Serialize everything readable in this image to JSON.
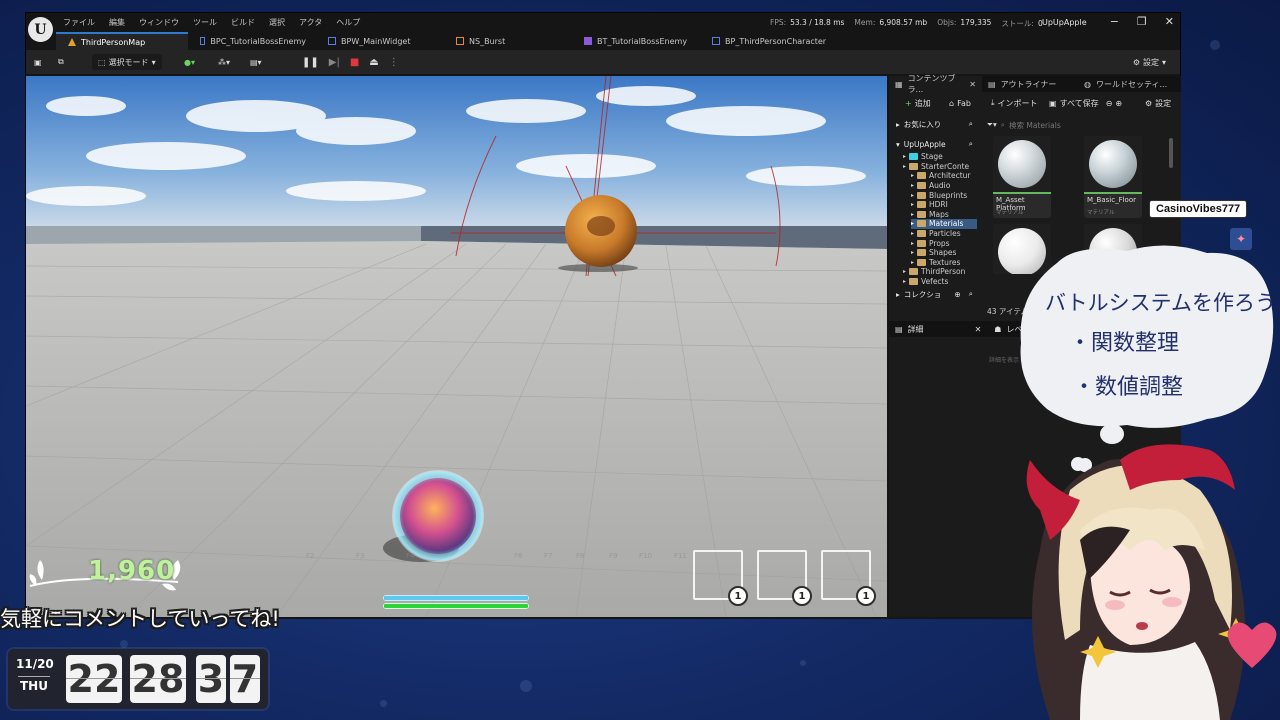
{
  "editor": {
    "menu": [
      "ファイル",
      "編集",
      "ウィンドウ",
      "ツール",
      "ビルド",
      "選択",
      "アクタ",
      "ヘルプ"
    ],
    "stats": {
      "fps_label": "FPS:",
      "fps_value": "53.3 / 18.8 ms",
      "mem_label": "Mem:",
      "mem_value": "6,908.57 mb",
      "objs_label": "Objs:",
      "objs_value": "179,335",
      "stalls_label": "ストール:",
      "stalls_value": "0"
    },
    "project_name": "UpUpApple",
    "tabs": [
      {
        "label": "ThirdPersonMap",
        "icon_color": "#e0a234"
      },
      {
        "label": "BPC_TutorialBossEnemy",
        "icon_color": "#5a7ee0"
      },
      {
        "label": "BPW_MainWidget",
        "icon_color": "#5a7ee0"
      },
      {
        "label": "NS_Burst",
        "icon_color": "#e28a3b"
      },
      {
        "label": "BT_TutorialBossEnemy",
        "icon_color": "#8b5ad9"
      },
      {
        "label": "BP_ThirdPersonCharacter",
        "icon_color": "#5a7ee0"
      }
    ],
    "toolbar": {
      "mode_label": "選択モード",
      "settings_label": "設定"
    }
  },
  "content_browser": {
    "panel_tabs": [
      "コンテンツブラ...",
      "アウトライナー",
      "ワールドセッティ..."
    ],
    "add_label": "追加",
    "fab_label": "Fab",
    "import_label": "インポート",
    "save_all_label": "すべて保存",
    "settings_label": "設定",
    "favorites_label": "お気に入り",
    "project_label": "UpUpApple",
    "collections_label": "コレクショ",
    "tree": [
      {
        "label": "Stage",
        "indent": 1,
        "selected": false,
        "icon": "cyan"
      },
      {
        "label": "StarterConte",
        "indent": 1,
        "selected": false,
        "icon": "folder"
      },
      {
        "label": "Architectur",
        "indent": 2,
        "selected": false,
        "icon": "folder"
      },
      {
        "label": "Audio",
        "indent": 2,
        "selected": false,
        "icon": "folder"
      },
      {
        "label": "Blueprints",
        "indent": 2,
        "selected": false,
        "icon": "folder"
      },
      {
        "label": "HDRI",
        "indent": 2,
        "selected": false,
        "icon": "folder"
      },
      {
        "label": "Maps",
        "indent": 2,
        "selected": false,
        "icon": "folder"
      },
      {
        "label": "Materials",
        "indent": 2,
        "selected": true,
        "icon": "folder"
      },
      {
        "label": "Particles",
        "indent": 2,
        "selected": false,
        "icon": "folder"
      },
      {
        "label": "Props",
        "indent": 2,
        "selected": false,
        "icon": "folder"
      },
      {
        "label": "Shapes",
        "indent": 2,
        "selected": false,
        "icon": "folder"
      },
      {
        "label": "Textures",
        "indent": 2,
        "selected": false,
        "icon": "folder"
      },
      {
        "label": "ThirdPerson",
        "indent": 1,
        "selected": false,
        "icon": "folder"
      },
      {
        "label": "Vefects",
        "indent": 1,
        "selected": false,
        "icon": "folder"
      }
    ],
    "search_placeholder": "検索 Materials",
    "assets": [
      {
        "name": "M_Asset\nPlatform",
        "type": "マテリアル"
      },
      {
        "name": "M_Basic_Floor",
        "type": "マテリアル"
      },
      {
        "name": "",
        "type": ""
      },
      {
        "name": "",
        "type": ""
      }
    ],
    "item_count": "43 アイテム",
    "details_label": "詳細",
    "level_label": "レベ",
    "details_hint": "詳細を表示"
  },
  "hud": {
    "slots": [
      "1",
      "1",
      "1"
    ],
    "health_fraction": 1.0,
    "mana_fraction": 1.0
  },
  "overlay": {
    "score": "1,960",
    "comment_banner": "気軽にコメントしていってね!",
    "clock": {
      "date": "11/20",
      "dow": "THU",
      "h": "22",
      "m": "28",
      "s1": "3",
      "s2": "7"
    },
    "bubble_title": "バトルシステムを作ろう",
    "bubble_items": [
      "・関数整理",
      "・数値調整"
    ],
    "username": "CasinoVibes777"
  },
  "colors": {
    "accent": "#2f7ad1",
    "score_green": "#bff29a",
    "health_bar": "#2bd43a",
    "mana_bar": "#5cc9f0"
  }
}
